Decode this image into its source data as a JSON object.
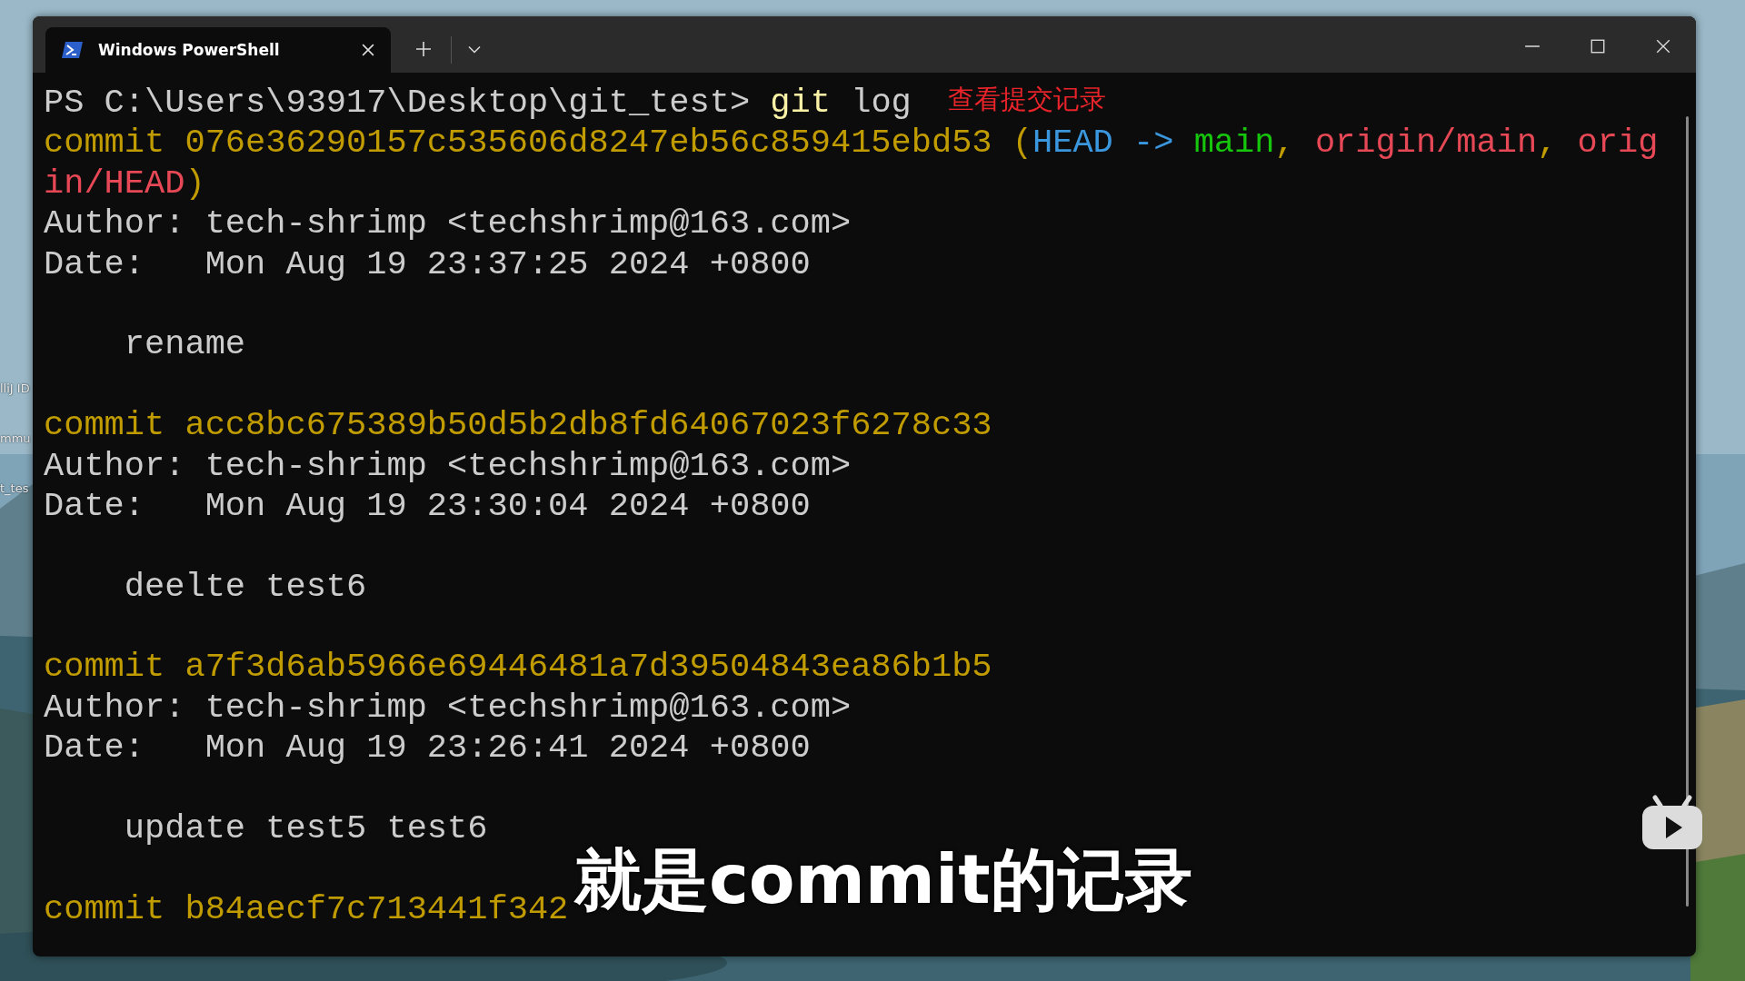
{
  "desktop": {
    "icons": [
      {
        "label": "lliJ ID"
      },
      {
        "label": "mmu"
      },
      {
        "label": "t_tes"
      }
    ]
  },
  "window": {
    "tab": {
      "title": "Windows PowerShell",
      "selected": true
    }
  },
  "terminal": {
    "lines": [
      {
        "kind": "text",
        "segments": [
          {
            "text": "PS C:\\Users\\93917\\Desktop\\git_test> ",
            "color": "#cccccc"
          },
          {
            "text": "git",
            "color": "#f9f1a5"
          },
          {
            "text": " log",
            "color": "#cccccc"
          }
        ]
      },
      {
        "kind": "text",
        "segments": [
          {
            "text": "commit 076e36290157c535606d8247eb56c859415ebd53 (",
            "color": "#c19c00"
          },
          {
            "text": "HEAD -> ",
            "color": "#3a96dd"
          },
          {
            "text": "main",
            "color": "#16c60c"
          },
          {
            "text": ", ",
            "color": "#c19c00"
          },
          {
            "text": "origin/main",
            "color": "#e74856"
          },
          {
            "text": ", ",
            "color": "#c19c00"
          },
          {
            "text": "orig",
            "color": "#e74856"
          }
        ]
      },
      {
        "kind": "text",
        "segments": [
          {
            "text": "in/HEAD",
            "color": "#e74856"
          },
          {
            "text": ")",
            "color": "#c19c00"
          }
        ]
      },
      {
        "kind": "text",
        "segments": [
          {
            "text": "Author: tech-shrimp <techshrimp@163.com>",
            "color": "#cccccc"
          }
        ]
      },
      {
        "kind": "text",
        "segments": [
          {
            "text": "Date:   Mon Aug 19 23:37:25 2024 +0800",
            "color": "#cccccc"
          }
        ]
      },
      {
        "kind": "blank"
      },
      {
        "kind": "text",
        "segments": [
          {
            "text": "    rename",
            "color": "#cccccc"
          }
        ]
      },
      {
        "kind": "blank"
      },
      {
        "kind": "text",
        "segments": [
          {
            "text": "commit acc8bc675389b50d5b2db8fd64067023f6278c33",
            "color": "#c19c00"
          }
        ]
      },
      {
        "kind": "text",
        "segments": [
          {
            "text": "Author: tech-shrimp <techshrimp@163.com>",
            "color": "#cccccc"
          }
        ]
      },
      {
        "kind": "text",
        "segments": [
          {
            "text": "Date:   Mon Aug 19 23:30:04 2024 +0800",
            "color": "#cccccc"
          }
        ]
      },
      {
        "kind": "blank"
      },
      {
        "kind": "text",
        "segments": [
          {
            "text": "    deelte test6",
            "color": "#cccccc"
          }
        ]
      },
      {
        "kind": "blank"
      },
      {
        "kind": "text",
        "segments": [
          {
            "text": "commit a7f3d6ab5966e69446481a7d39504843ea86b1b5",
            "color": "#c19c00"
          }
        ]
      },
      {
        "kind": "text",
        "segments": [
          {
            "text": "Author: tech-shrimp <techshrimp@163.com>",
            "color": "#cccccc"
          }
        ]
      },
      {
        "kind": "text",
        "segments": [
          {
            "text": "Date:   Mon Aug 19 23:26:41 2024 +0800",
            "color": "#cccccc"
          }
        ]
      },
      {
        "kind": "blank"
      },
      {
        "kind": "text",
        "segments": [
          {
            "text": "    update test5 test6",
            "color": "#cccccc"
          }
        ]
      },
      {
        "kind": "blank"
      },
      {
        "kind": "text",
        "segments": [
          {
            "text": "commit b84aecf7c713441f342",
            "color": "#c19c00"
          }
        ]
      }
    ]
  },
  "annotation": "查看提交记录",
  "subtitle": "就是commit的记录"
}
